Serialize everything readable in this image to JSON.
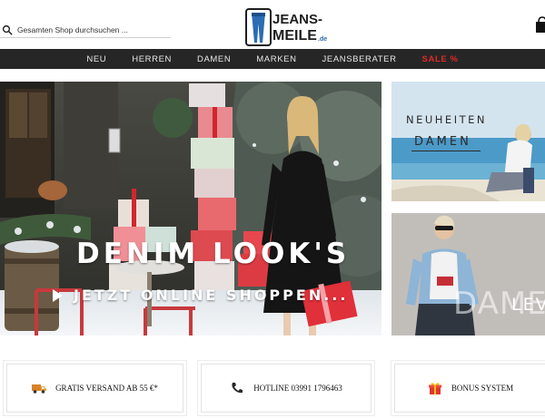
{
  "header": {
    "search_placeholder": "Gesamten Shop durchsuchen ...",
    "logo": {
      "word1": "JEANS-",
      "word2": "MEILE",
      "suffix": ".de"
    }
  },
  "nav": {
    "items": [
      {
        "label": "NEU"
      },
      {
        "label": "HERREN"
      },
      {
        "label": "DAMEN"
      },
      {
        "label": "MARKEN"
      },
      {
        "label": "JEANSBERATER"
      },
      {
        "label": "SALE %",
        "color": "#e02a2a"
      }
    ]
  },
  "hero": {
    "title": "DENIM LOOK'S",
    "cta": "JETZT ONLINE SHOPPEN..."
  },
  "banners": {
    "neuheiten": {
      "line1": "NEUHEITEN",
      "line2": "DAMEN"
    },
    "second": {
      "ghost": "DAME",
      "label": "LEV"
    }
  },
  "features": [
    {
      "icon": "truck-icon",
      "label": "GRATIS VERSAND AB 55 €*"
    },
    {
      "icon": "phone-icon",
      "label": "HOTLINE 03991 1796463"
    },
    {
      "icon": "gift-icon",
      "label": "BONUS SYSTEM"
    }
  ],
  "colors": {
    "nav_bg": "#262626",
    "sale": "#e02a2a",
    "logo_blue": "#2b6cb3"
  }
}
